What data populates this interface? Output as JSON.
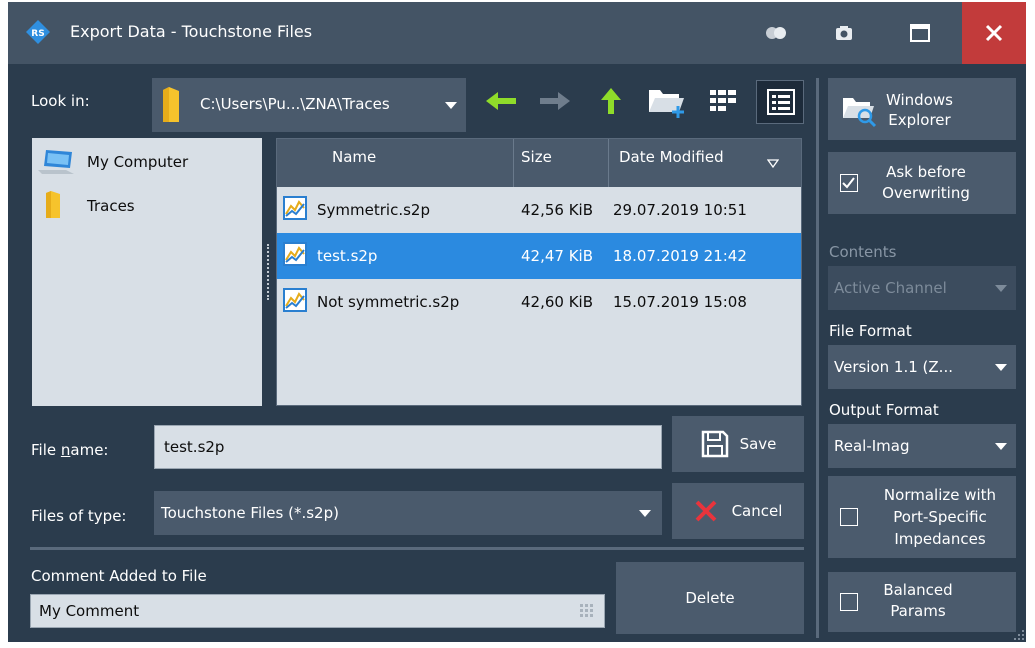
{
  "window": {
    "title": "Export Data - Touchstone Files"
  },
  "toolbar": {
    "look_in_label": "Look in:",
    "look_in_path": "C:\\Users\\Pu...\\ZNA\\Traces"
  },
  "sidebar": {
    "items": [
      {
        "label": "My Computer",
        "icon": "computer-icon"
      },
      {
        "label": "Traces",
        "icon": "folder-icon"
      }
    ]
  },
  "file_list": {
    "columns": [
      "Name",
      "Size",
      "Date Modified"
    ],
    "sort_column": "Date Modified",
    "rows": [
      {
        "name": "Symmetric.s2p",
        "size": "42,56 KiB",
        "modified": "29.07.2019 10:51",
        "selected": false
      },
      {
        "name": "test.s2p",
        "size": "42,47 KiB",
        "modified": "18.07.2019 21:42",
        "selected": true
      },
      {
        "name": "Not symmetric.s2p",
        "size": "42,60 KiB",
        "modified": "15.07.2019 15:08",
        "selected": false
      }
    ]
  },
  "form": {
    "file_name_label": "File name:",
    "file_name_value": "test.s2p",
    "files_of_type_label": "Files of type:",
    "files_of_type_value": "Touchstone Files (*.s2p)",
    "save_label": "Save",
    "cancel_label": "Cancel",
    "comment_label": "Comment Added to File",
    "comment_value": "My Comment",
    "delete_label": "Delete"
  },
  "right_panel": {
    "windows_explorer_label": "Windows\nExplorer",
    "ask_overwrite_label": "Ask before\nOverwriting",
    "ask_overwrite_checked": true,
    "contents_label": "Contents",
    "contents_value": "Active Channel",
    "file_format_label": "File Format",
    "file_format_value": "Version 1.1 (Z...",
    "output_format_label": "Output Format",
    "output_format_value": "Real-Imag",
    "normalize_label": "Normalize with\nPort-Specific\nImpedances",
    "normalize_checked": false,
    "balanced_label": "Balanced\nParams",
    "balanced_checked": false
  },
  "colors": {
    "background": "#2b3c4d",
    "titlebar": "#445465",
    "close": "#c23b3b",
    "selection": "#2b8ae0",
    "nav_green": "#8fdc2a",
    "cancel_red": "#e8343c"
  }
}
